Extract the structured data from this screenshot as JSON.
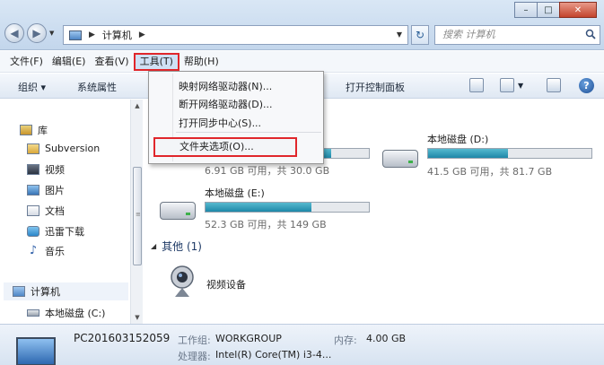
{
  "window": {
    "controls": [
      "–",
      "□",
      "✕"
    ]
  },
  "address": {
    "location": "计算机",
    "search_placeholder": "搜索 计算机"
  },
  "menubar": {
    "items": [
      "文件(F)",
      "编辑(E)",
      "查看(V)",
      "工具(T)",
      "帮助(H)"
    ]
  },
  "toolbar": {
    "organize": "组织 ▾",
    "system_properties": "系统属性",
    "control_panel": "打开控制面板"
  },
  "tools_menu": {
    "items": [
      "映射网络驱动器(N)...",
      "断开网络驱动器(D)...",
      "打开同步中心(S)...",
      "文件夹选项(O)..."
    ]
  },
  "sidebar": {
    "library": "库",
    "items": [
      "Subversion",
      "视频",
      "图片",
      "文档",
      "迅雷下载",
      "音乐"
    ],
    "computer": "计算机",
    "local_disk_c": "本地磁盘 (C:)"
  },
  "drives": [
    {
      "name": "",
      "info": "6.91 GB 可用，共 30.0 GB",
      "used_fraction": 0.77
    },
    {
      "name": "本地磁盘 (D:)",
      "info": "41.5 GB 可用，共 81.7 GB",
      "used_fraction": 0.49
    },
    {
      "name": "本地磁盘 (E:)",
      "info": "52.3 GB 可用，共 149 GB",
      "used_fraction": 0.65
    }
  ],
  "other_group": {
    "header": "其他 (1)",
    "device": "视频设备"
  },
  "details": {
    "pc_name": "PC201603152059",
    "workgroup_label": "工作组:",
    "workgroup": "WORKGROUP",
    "memory_label": "内存:",
    "memory": "4.00 GB",
    "cpu_label": "处理器:",
    "cpu": "Intel(R) Core(TM) i3-4..."
  },
  "colors": {
    "highlight_border": "#e0262b",
    "drive_bar": "#1e88a8"
  }
}
